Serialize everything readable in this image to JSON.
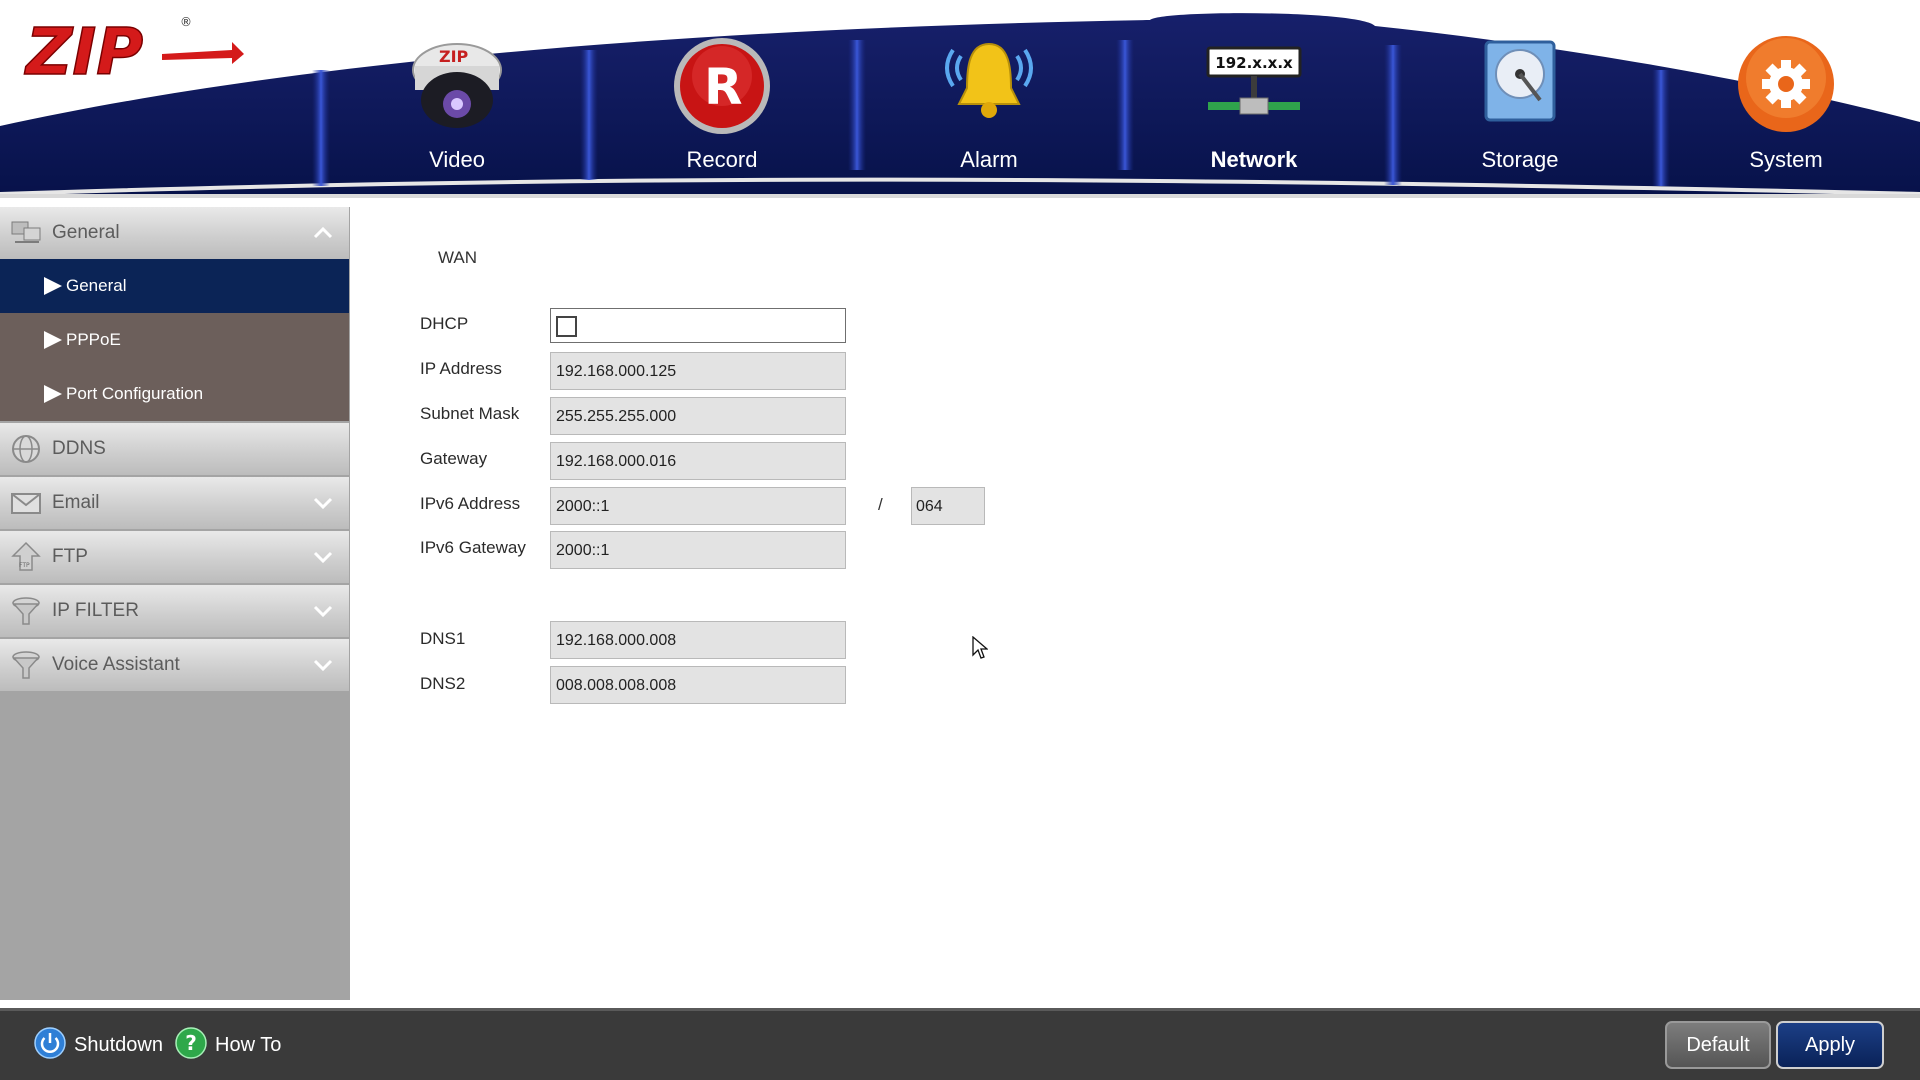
{
  "header": {
    "logo_text": "ZIP",
    "nav": [
      {
        "label": "Video",
        "icon": "camera-icon"
      },
      {
        "label": "Record",
        "icon": "record-icon"
      },
      {
        "label": "Alarm",
        "icon": "bell-icon"
      },
      {
        "label": "Network",
        "icon": "network-icon",
        "icon_text": "192.x.x.x",
        "active": true
      },
      {
        "label": "Storage",
        "icon": "hard-drive-icon"
      },
      {
        "label": "System",
        "icon": "gear-icon"
      }
    ]
  },
  "sidebar": {
    "categories": [
      {
        "label": "General",
        "icon": "network-general-icon",
        "expanded": true,
        "items": [
          {
            "label": "General",
            "active": true
          },
          {
            "label": "PPPoE"
          },
          {
            "label": "Port Configuration"
          }
        ]
      },
      {
        "label": "DDNS",
        "icon": "globe-icon"
      },
      {
        "label": "Email",
        "icon": "envelope-icon"
      },
      {
        "label": "FTP",
        "icon": "ftp-icon"
      },
      {
        "label": "IP FILTER",
        "icon": "filter-icon"
      },
      {
        "label": "Voice Assistant",
        "icon": "filter-icon"
      }
    ]
  },
  "main": {
    "section_title": "WAN",
    "dhcp": {
      "label": "DHCP",
      "checked": false
    },
    "fields": {
      "ip_address": {
        "label": "IP Address",
        "value": "192.168.000.125"
      },
      "subnet_mask": {
        "label": "Subnet Mask",
        "value": "255.255.255.000"
      },
      "gateway": {
        "label": "Gateway",
        "value": "192.168.000.016"
      },
      "ipv6_address": {
        "label": "IPv6 Address",
        "value": "2000::1",
        "separator": "/",
        "prefix": "064"
      },
      "ipv6_gateway": {
        "label": "IPv6 Gateway",
        "value": "2000::1"
      },
      "dns1": {
        "label": "DNS1",
        "value": "192.168.000.008"
      },
      "dns2": {
        "label": "DNS2",
        "value": "008.008.008.008"
      }
    }
  },
  "footer": {
    "shutdown_label": "Shutdown",
    "howto_label": "How To",
    "default_label": "Default",
    "apply_label": "Apply"
  },
  "colors": {
    "header_navy": "#0b1a55",
    "active_item": "#0b2456",
    "submenu_bg": "#6c5f5b",
    "footer_bg": "#3a3a3a",
    "apply_blue": "#0a2258"
  }
}
